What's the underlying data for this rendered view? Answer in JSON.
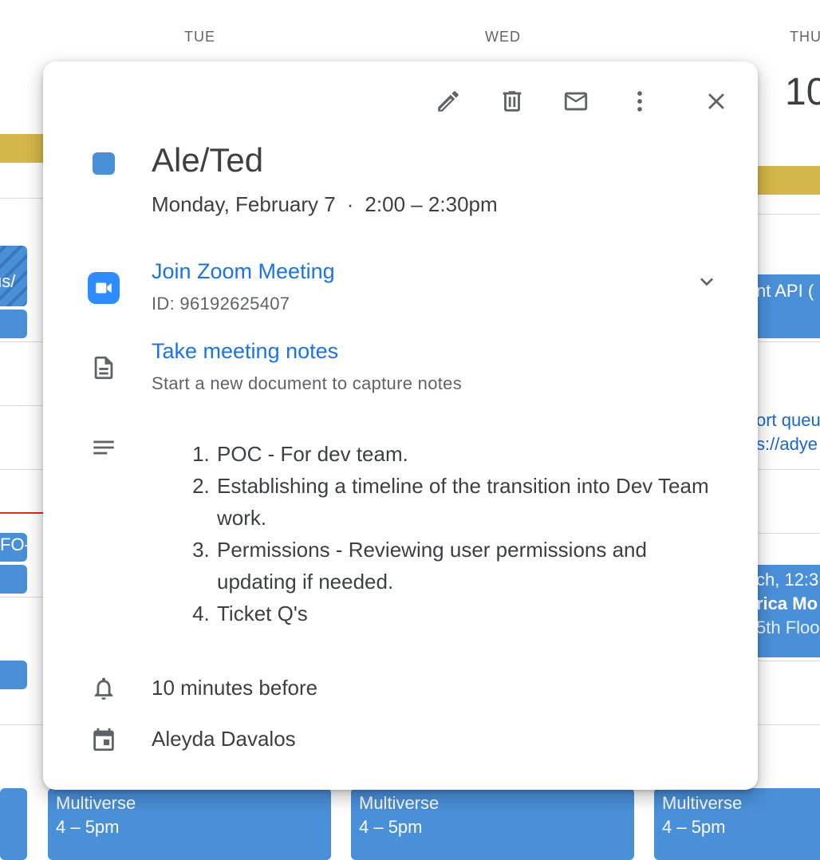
{
  "calendar": {
    "days": [
      "TUE",
      "WED",
      "THU"
    ],
    "thu_date_partial": "10",
    "left_events": [
      {
        "label": "us/"
      },
      {
        "label": ""
      },
      {
        "label": "FO-"
      },
      {
        "label": ""
      },
      {
        "label": ""
      }
    ],
    "right_events": [
      {
        "title": "nt API ("
      },
      {
        "title": "ort queu",
        "sub": "s://adye"
      },
      {
        "title": "ch, 12:3"
      },
      {
        "title": "rica Mo",
        "sub": "5th Floo"
      }
    ],
    "bottom_events": [
      {
        "title": "Multiverse",
        "time": "4 – 5pm"
      },
      {
        "title": "Multiverse",
        "time": "4 – 5pm"
      },
      {
        "title": "Multiverse",
        "time": "4 – 5pm"
      }
    ]
  },
  "event": {
    "title": "Ale/Ted",
    "date": "Monday, February 7",
    "separator": "·",
    "time": "2:00 – 2:30pm",
    "color": "#4a90d9",
    "zoom": {
      "link_label": "Join Zoom Meeting",
      "meeting_id": "ID: 96192625407"
    },
    "notes": {
      "link_label": "Take meeting notes",
      "subtitle": "Start a new document to capture notes"
    },
    "description": [
      "POC - For dev team.",
      "Establishing a timeline of the transition into Dev Team work.",
      "Permissions - Reviewing user permissions and updating if needed.",
      "Ticket Q's"
    ],
    "reminder": "10 minutes before",
    "organizer": "Aleyda Davalos"
  },
  "toolbar_icons": [
    "edit-icon",
    "delete-icon",
    "email-icon",
    "more-options-icon",
    "close-icon"
  ]
}
